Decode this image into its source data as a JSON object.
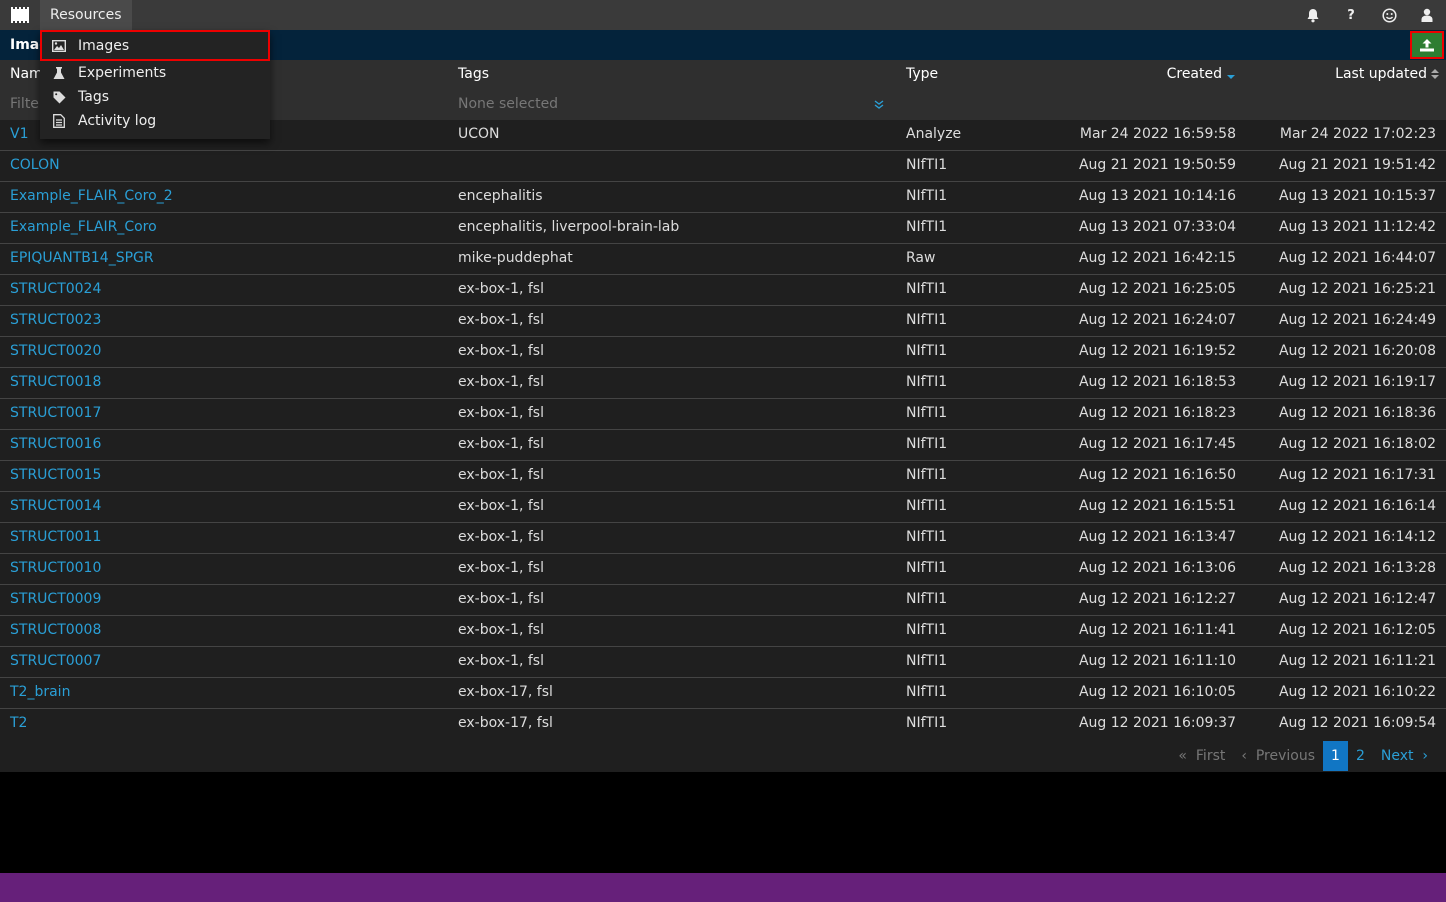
{
  "navbar": {
    "logo": "app-logo",
    "resources_label": "Resources",
    "right_icons": [
      "bell-icon",
      "question-icon",
      "smiley-icon",
      "user-icon"
    ]
  },
  "dropdown": {
    "items": [
      {
        "label": "Images",
        "icon": "image-icon",
        "selected": true
      },
      {
        "label": "Experiments",
        "icon": "flask-icon",
        "selected": false
      },
      {
        "label": "Tags",
        "icon": "tag-icon",
        "selected": false
      },
      {
        "label": "Activity log",
        "icon": "document-icon",
        "selected": false
      }
    ]
  },
  "titlebar": {
    "title": "Images",
    "upload_icon": "upload-icon"
  },
  "table": {
    "headers": {
      "name": "Name",
      "tags": "Tags",
      "type": "Type",
      "created": "Created",
      "updated": "Last updated"
    },
    "sort": {
      "created": "descending",
      "updated": "unsorted"
    },
    "filters": {
      "name_placeholder": "Filter",
      "tags_placeholder": "None selected"
    },
    "rows": [
      {
        "name": "V1",
        "tags": "UCON",
        "type": "Analyze",
        "created": "Mar 24 2022 16:59:58",
        "updated": "Mar 24 2022 17:02:23"
      },
      {
        "name": "COLON",
        "tags": "",
        "type": "NIfTI1",
        "created": "Aug 21 2021 19:50:59",
        "updated": "Aug 21 2021 19:51:42"
      },
      {
        "name": "Example_FLAIR_Coro_2",
        "tags": "encephalitis",
        "type": "NIfTI1",
        "created": "Aug 13 2021 10:14:16",
        "updated": "Aug 13 2021 10:15:37"
      },
      {
        "name": "Example_FLAIR_Coro",
        "tags": "encephalitis, liverpool-brain-lab",
        "type": "NIfTI1",
        "created": "Aug 13 2021 07:33:04",
        "updated": "Aug 13 2021 11:12:42"
      },
      {
        "name": "EPIQUANTB14_SPGR",
        "tags": "mike-puddephat",
        "type": "Raw",
        "created": "Aug 12 2021 16:42:15",
        "updated": "Aug 12 2021 16:44:07"
      },
      {
        "name": "STRUCT0024",
        "tags": "ex-box-1, fsl",
        "type": "NIfTI1",
        "created": "Aug 12 2021 16:25:05",
        "updated": "Aug 12 2021 16:25:21"
      },
      {
        "name": "STRUCT0023",
        "tags": "ex-box-1, fsl",
        "type": "NIfTI1",
        "created": "Aug 12 2021 16:24:07",
        "updated": "Aug 12 2021 16:24:49"
      },
      {
        "name": "STRUCT0020",
        "tags": "ex-box-1, fsl",
        "type": "NIfTI1",
        "created": "Aug 12 2021 16:19:52",
        "updated": "Aug 12 2021 16:20:08"
      },
      {
        "name": "STRUCT0018",
        "tags": "ex-box-1, fsl",
        "type": "NIfTI1",
        "created": "Aug 12 2021 16:18:53",
        "updated": "Aug 12 2021 16:19:17"
      },
      {
        "name": "STRUCT0017",
        "tags": "ex-box-1, fsl",
        "type": "NIfTI1",
        "created": "Aug 12 2021 16:18:23",
        "updated": "Aug 12 2021 16:18:36"
      },
      {
        "name": "STRUCT0016",
        "tags": "ex-box-1, fsl",
        "type": "NIfTI1",
        "created": "Aug 12 2021 16:17:45",
        "updated": "Aug 12 2021 16:18:02"
      },
      {
        "name": "STRUCT0015",
        "tags": "ex-box-1, fsl",
        "type": "NIfTI1",
        "created": "Aug 12 2021 16:16:50",
        "updated": "Aug 12 2021 16:17:31"
      },
      {
        "name": "STRUCT0014",
        "tags": "ex-box-1, fsl",
        "type": "NIfTI1",
        "created": "Aug 12 2021 16:15:51",
        "updated": "Aug 12 2021 16:16:14"
      },
      {
        "name": "STRUCT0011",
        "tags": "ex-box-1, fsl",
        "type": "NIfTI1",
        "created": "Aug 12 2021 16:13:47",
        "updated": "Aug 12 2021 16:14:12"
      },
      {
        "name": "STRUCT0010",
        "tags": "ex-box-1, fsl",
        "type": "NIfTI1",
        "created": "Aug 12 2021 16:13:06",
        "updated": "Aug 12 2021 16:13:28"
      },
      {
        "name": "STRUCT0009",
        "tags": "ex-box-1, fsl",
        "type": "NIfTI1",
        "created": "Aug 12 2021 16:12:27",
        "updated": "Aug 12 2021 16:12:47"
      },
      {
        "name": "STRUCT0008",
        "tags": "ex-box-1, fsl",
        "type": "NIfTI1",
        "created": "Aug 12 2021 16:11:41",
        "updated": "Aug 12 2021 16:12:05"
      },
      {
        "name": "STRUCT0007",
        "tags": "ex-box-1, fsl",
        "type": "NIfTI1",
        "created": "Aug 12 2021 16:11:10",
        "updated": "Aug 12 2021 16:11:21"
      },
      {
        "name": "T2_brain",
        "tags": "ex-box-17, fsl",
        "type": "NIfTI1",
        "created": "Aug 12 2021 16:10:05",
        "updated": "Aug 12 2021 16:10:22"
      },
      {
        "name": "T2",
        "tags": "ex-box-17, fsl",
        "type": "NIfTI1",
        "created": "Aug 12 2021 16:09:37",
        "updated": "Aug 12 2021 16:09:54"
      }
    ]
  },
  "pagination": {
    "first": "First",
    "previous": "Previous",
    "pages": [
      "1",
      "2"
    ],
    "current": "1",
    "next": "Next"
  },
  "colors": {
    "link": "#2a9fd6",
    "active_page": "#1176c4",
    "titlebar": "#04233b",
    "upload_button": "#2e7d32",
    "footer": "#66207a",
    "highlight_outline": "#ee0000"
  }
}
